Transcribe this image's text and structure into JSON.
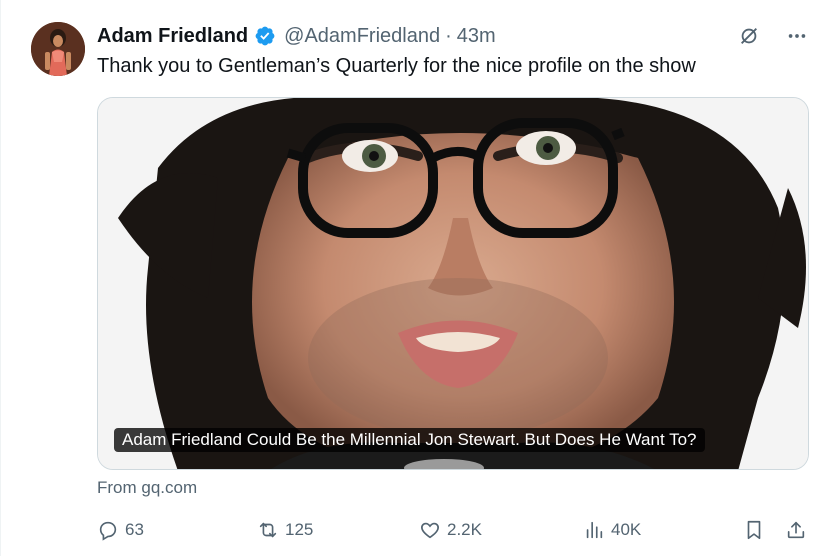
{
  "tweet": {
    "author_name": "Adam Friedland",
    "handle": "@AdamFriedland",
    "separator": "·",
    "time_ago": "43m",
    "text": "Thank you to Gentleman’s Quarterly for the nice profile on the show",
    "verified": true
  },
  "card": {
    "title": "Adam Friedland Could Be the Millennial Jon Stewart. But Does He Want To?",
    "source": "From gq.com"
  },
  "actions": {
    "replies": "63",
    "reposts": "125",
    "likes": "2.2K",
    "views": "40K"
  },
  "colors": {
    "verified_blue": "#1d9bf0",
    "muted_text": "#536471",
    "primary_text": "#0f1419"
  },
  "icons": [
    "grok-icon",
    "more-icon",
    "reply-icon",
    "repost-icon",
    "like-icon",
    "views-icon",
    "bookmark-icon",
    "share-icon"
  ]
}
